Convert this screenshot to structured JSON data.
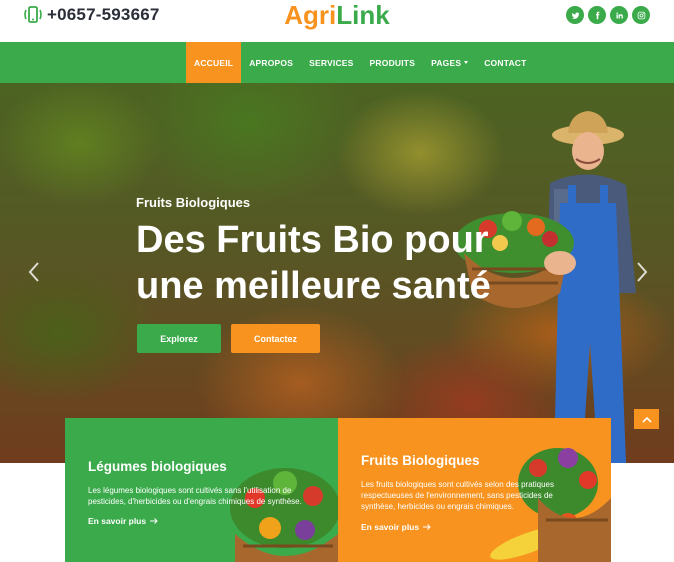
{
  "topbar": {
    "phone": "+0657-593667",
    "logo_part1": "Agri",
    "logo_part2": "Link",
    "socials": [
      "twitter-icon",
      "facebook-icon",
      "linkedin-icon",
      "instagram-icon"
    ]
  },
  "nav": {
    "items": [
      {
        "label": "ACCUEIL",
        "active": true
      },
      {
        "label": "APROPOS"
      },
      {
        "label": "SERVICES"
      },
      {
        "label": "PRODUITS"
      },
      {
        "label": "PAGES",
        "dropdown": true
      },
      {
        "label": "CONTACT"
      }
    ]
  },
  "hero": {
    "subtitle": "Fruits Biologiques",
    "title": "Des Fruits Bio pour une meilleure santé",
    "btn_primary": "Explorez",
    "btn_secondary": "Contactez"
  },
  "cards": [
    {
      "title": "Légumes biologiques",
      "text": "Les légumes biologiques sont cultivés sans l'utilisation de pesticides, d'herbicides ou d'engrais chimiques de synthèse.",
      "link": "En savoir plus"
    },
    {
      "title": "Fruits Biologiques",
      "text": "Les fruits biologiques sont cultivés selon des pratiques respectueuses de l'environnement, sans pesticides de synthèse, herbicides ou engrais chimiques.",
      "link": "En savoir plus"
    }
  ],
  "colors": {
    "green": "#3aaa4b",
    "orange": "#f7931e",
    "dark_text": "#2a2e38"
  }
}
